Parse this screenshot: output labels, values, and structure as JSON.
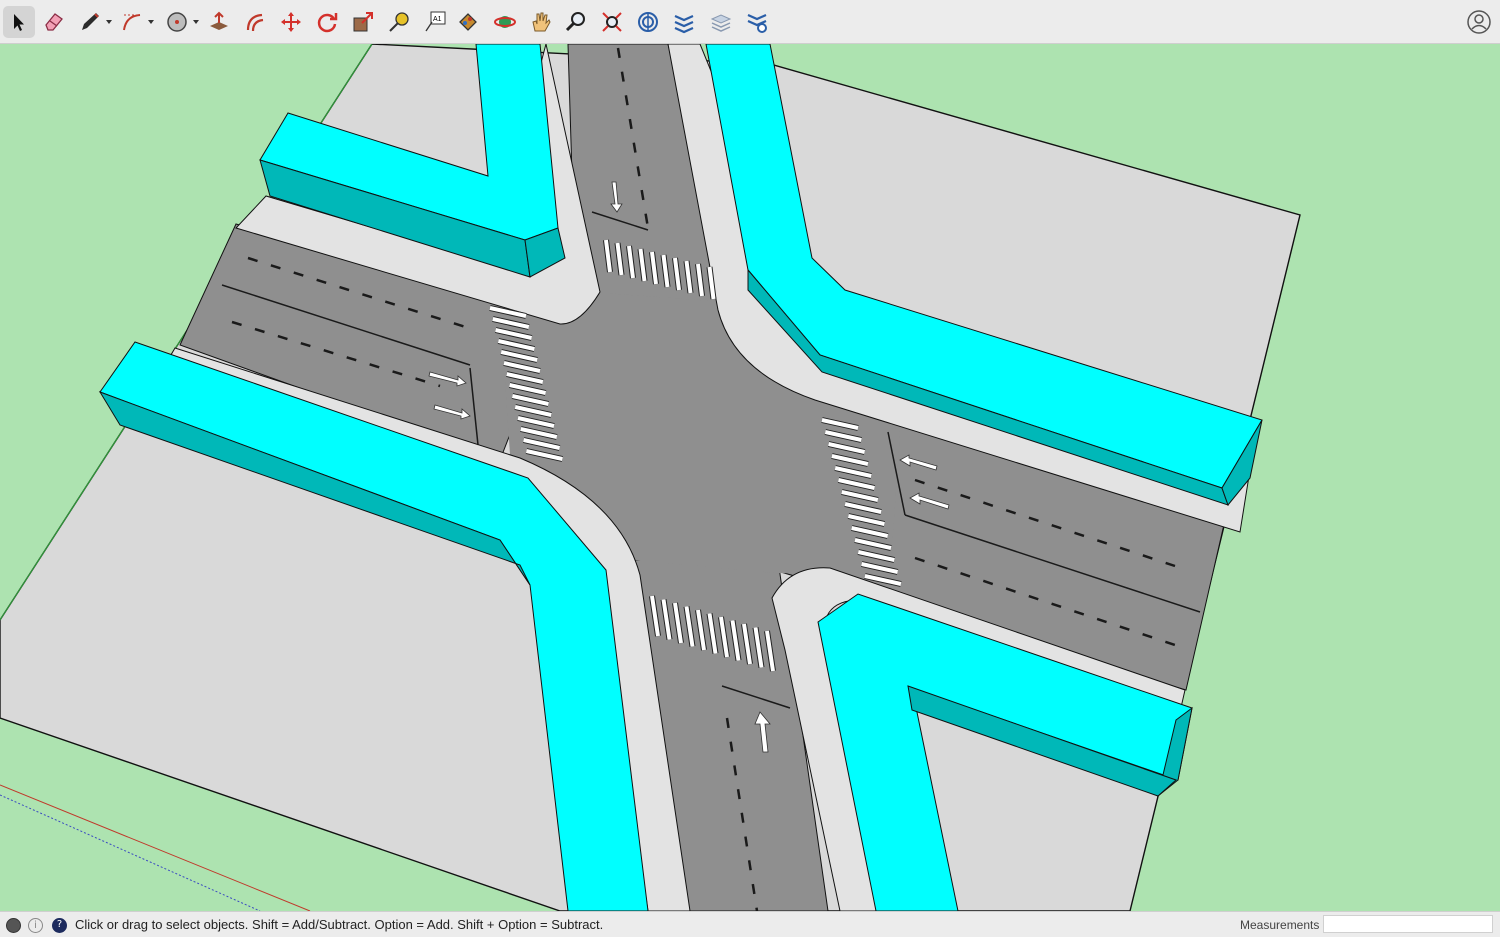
{
  "toolbar": {
    "tools": [
      {
        "name": "select-tool",
        "icon": "arrow-cursor-icon",
        "active": true
      },
      {
        "name": "eraser-tool",
        "icon": "eraser-icon"
      },
      {
        "name": "line-tool",
        "icon": "pencil-icon",
        "has_menu": true
      },
      {
        "name": "arc-tool",
        "icon": "arc-icon",
        "has_menu": true
      },
      {
        "name": "shape-tool",
        "icon": "circle-shape-icon",
        "has_menu": true
      },
      {
        "name": "push-pull-tool",
        "icon": "push-pull-icon"
      },
      {
        "name": "offset-tool",
        "icon": "offset-icon"
      },
      {
        "name": "move-tool",
        "icon": "move-arrows-icon"
      },
      {
        "name": "rotate-tool",
        "icon": "rotate-icon"
      },
      {
        "name": "scale-tool",
        "icon": "scale-icon"
      },
      {
        "name": "tape-measure-tool",
        "icon": "tape-measure-icon"
      },
      {
        "name": "text-tool",
        "icon": "text-icon"
      },
      {
        "name": "paint-bucket-tool",
        "icon": "paint-bucket-icon"
      },
      {
        "name": "orbit-tool",
        "icon": "orbit-icon"
      },
      {
        "name": "pan-tool",
        "icon": "hand-icon"
      },
      {
        "name": "zoom-tool",
        "icon": "magnifier-icon"
      },
      {
        "name": "zoom-extents-tool",
        "icon": "zoom-extents-icon"
      },
      {
        "name": "warehouse-tool",
        "icon": "warehouse-icon"
      },
      {
        "name": "extension-warehouse-tool",
        "icon": "extension-warehouse-icon"
      },
      {
        "name": "layout-tool",
        "icon": "layers-icon"
      },
      {
        "name": "extension-manager-tool",
        "icon": "extension-manager-icon"
      }
    ],
    "text_tool_glyph": "A1",
    "user_icon": "user-account-icon"
  },
  "colors": {
    "ground": "#ade3b0",
    "sidewalk": "#d9d9d9",
    "curb": "#e6e6e6",
    "road": "#8f8f8f",
    "building_top": "#00ffff",
    "building_side": "#00b8b8",
    "marking": "#ffffff",
    "edge": "#1a1a1a"
  },
  "status": {
    "icons": [
      "credits-icon",
      "info-icon",
      "help-icon"
    ],
    "message": "Click or drag to select objects. Shift = Add/Subtract. Option = Add. Shift + Option = Subtract.",
    "measurements_label": "Measurements",
    "measurements_value": ""
  }
}
